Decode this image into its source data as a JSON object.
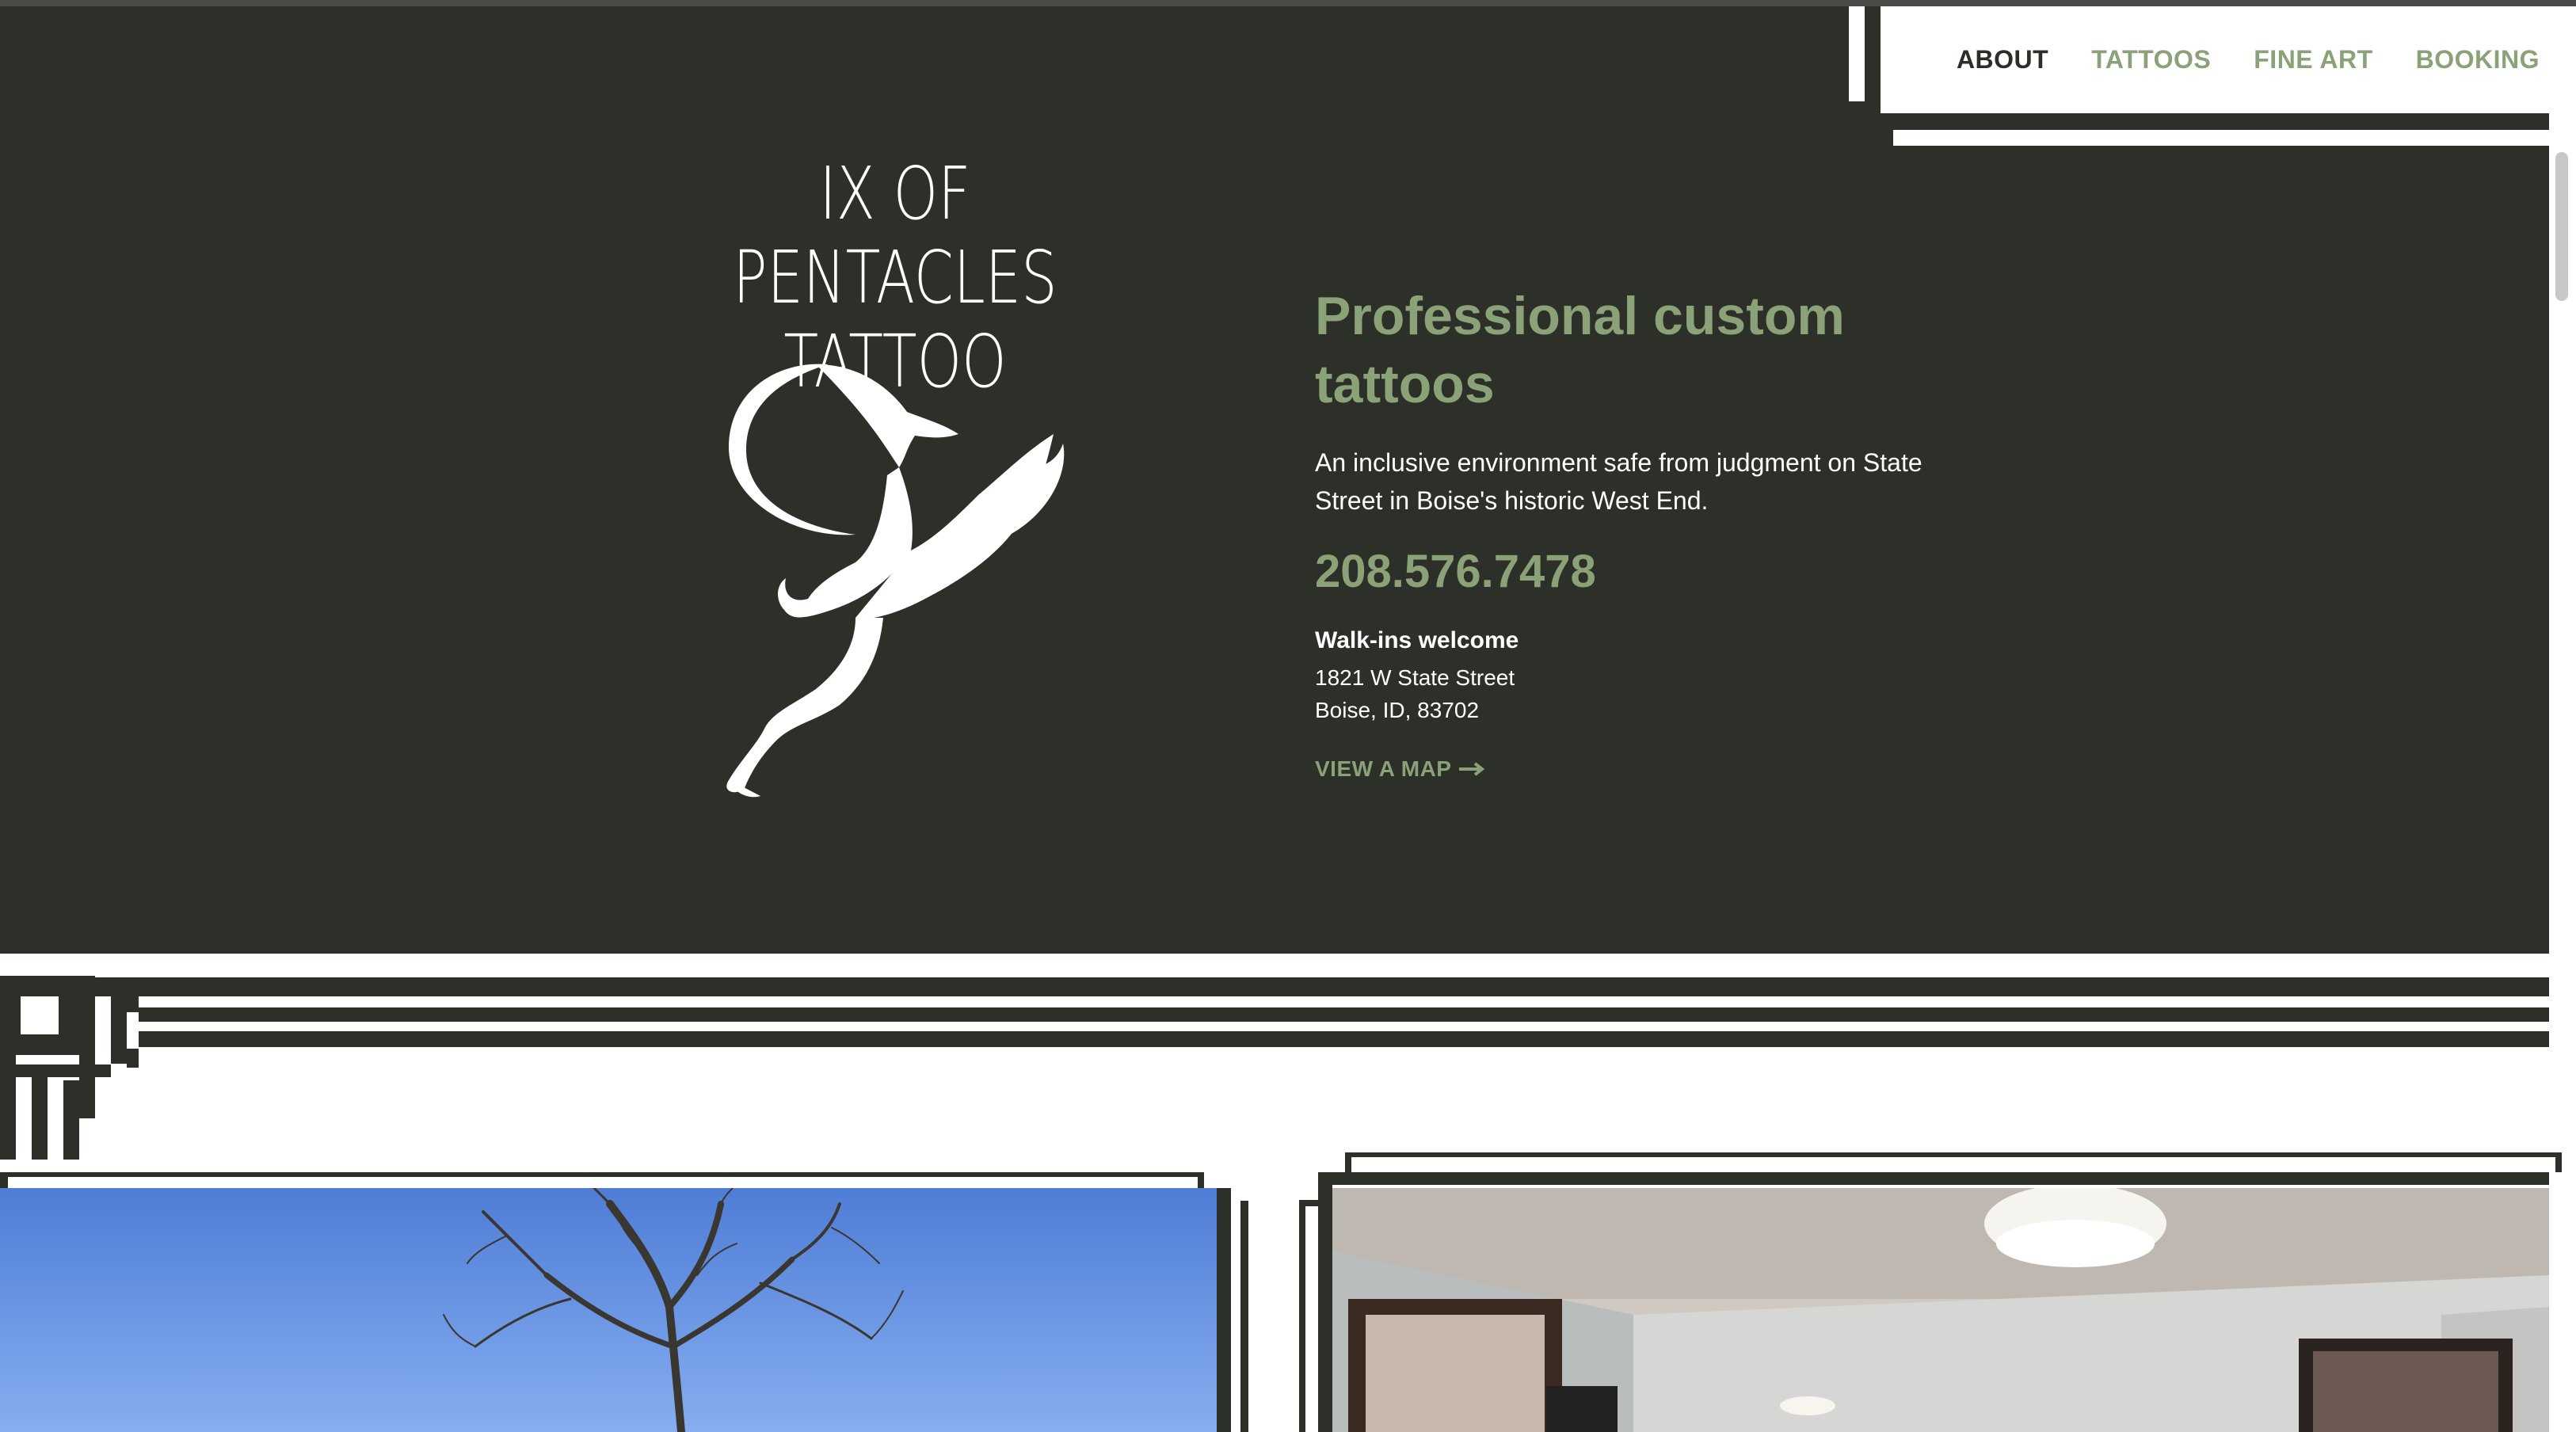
{
  "brand": {
    "logo_line1": "IX OF PENTACLES",
    "logo_line2": "TATTOO"
  },
  "nav": {
    "items": [
      {
        "label": "ABOUT",
        "active": true
      },
      {
        "label": "TATTOOS",
        "active": false
      },
      {
        "label": "FINE ART",
        "active": false
      },
      {
        "label": "BOOKING",
        "active": false
      }
    ]
  },
  "hero": {
    "headline": "Professional custom tattoos",
    "intro": "An inclusive environment safe from judgment on State Street in Boise's historic West End.",
    "phone": "208.576.7478",
    "walkins": "Walk-ins welcome",
    "address_line1": "1821 W State Street",
    "address_line2": "Boise, ID, 83702",
    "map_link": "VIEW A MAP",
    "map_icon": "arrow-right-icon"
  },
  "colors": {
    "background_dark": "#2c3028",
    "accent_green": "#8ba279",
    "text_light": "#ffffff",
    "nav_active": "#2a2e27"
  }
}
